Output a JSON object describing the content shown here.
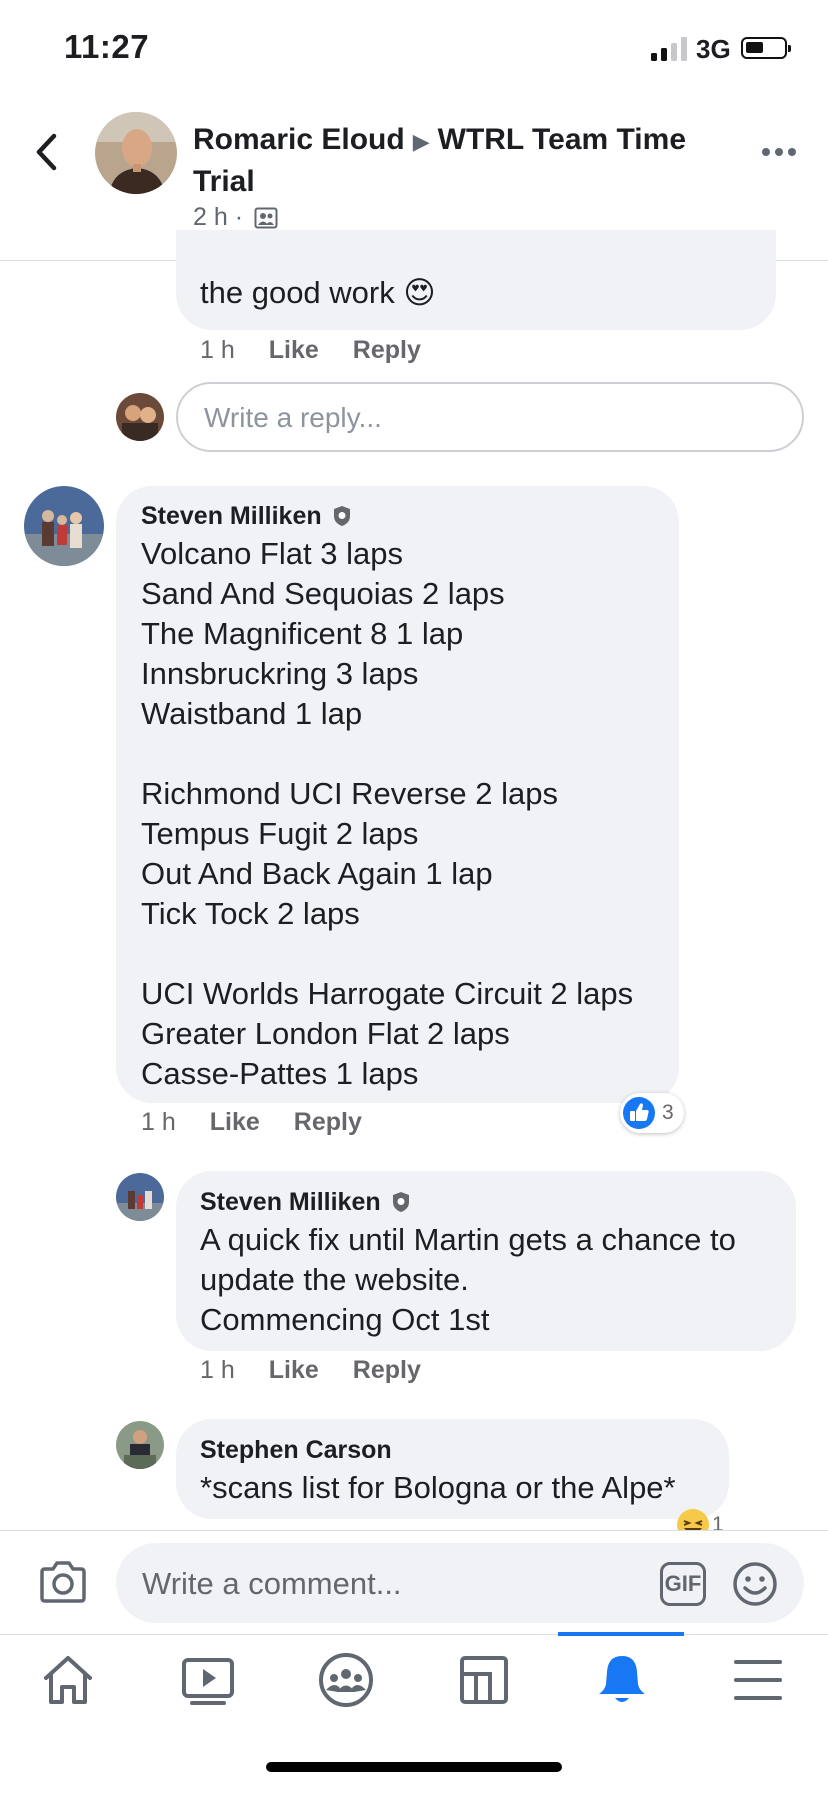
{
  "status_bar": {
    "time": "11:27",
    "network": "3G"
  },
  "header": {
    "author": "Romaric Eloud",
    "group": "WTRL Team Time Trial",
    "time": "2 h",
    "separator": "·"
  },
  "comments": [
    {
      "text": "the good work 😍",
      "time": "1 h",
      "like": "Like",
      "reply": "Reply"
    },
    {
      "author": "Steven Milliken",
      "text": "Volcano Flat 3 laps\nSand And Sequoias 2 laps\nThe Magnificent 8 1 lap\nInnsbruckring 3 laps\nWaistband 1 lap\n\nRichmond UCI Reverse 2 laps\nTempus Fugit 2 laps\nOut And Back Again 1 lap\nTick Tock 2 laps\n\nUCI Worlds Harrogate Circuit 2 laps\nGreater London Flat 2 laps\nCasse-Pattes  1 laps",
      "time": "1 h",
      "like": "Like",
      "reply": "Reply",
      "reaction_count": "3"
    },
    {
      "author": "Steven Milliken",
      "text": "A quick fix until Martin gets a chance to update the website.\nCommencing Oct 1st",
      "time": "1 h",
      "like": "Like",
      "reply": "Reply"
    },
    {
      "author": "Stephen Carson",
      "text": "*scans list for Bologna or the Alpe*",
      "reaction_count": "1"
    }
  ],
  "reply_input": {
    "placeholder": "Write a reply..."
  },
  "comment_input": {
    "placeholder": "Write a comment...",
    "gif_label": "GIF"
  },
  "icons": {
    "back": "chevron-left-icon",
    "more": "more-horizontal-icon",
    "privacy": "group-privacy-icon",
    "verified": "admin-shield-icon",
    "camera": "camera-icon",
    "emoji": "smiley-icon",
    "like_reaction": "thumbs-up-icon",
    "haha_reaction": "laughing-emoji-icon"
  },
  "tabs": [
    {
      "name": "home",
      "active": false
    },
    {
      "name": "watch",
      "active": false
    },
    {
      "name": "groups",
      "active": false
    },
    {
      "name": "pages",
      "active": false
    },
    {
      "name": "notifications",
      "active": true
    },
    {
      "name": "menu",
      "active": false
    }
  ],
  "colors": {
    "accent": "#1877f2",
    "bubble": "#f0f2f5",
    "secondary_text": "#65676b",
    "divider": "#dadde1"
  }
}
